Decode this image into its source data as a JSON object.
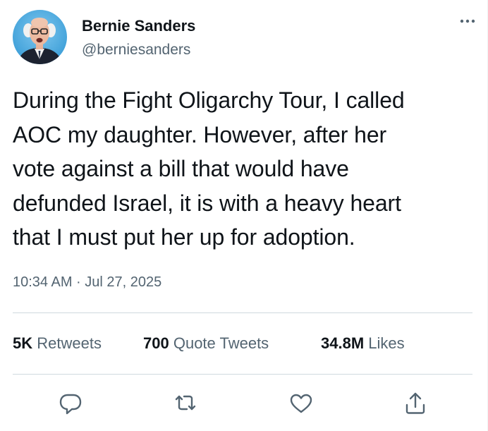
{
  "author": {
    "display_name": "Bernie Sanders",
    "handle": "@berniesanders",
    "avatar_icon": "profile-photo"
  },
  "tweet": {
    "text": "During the Fight Oligarchy Tour, I called\nAOC my daughter. However, after her\nvote against a bill that would have\ndefunded Israel, it is with a heavy heart\nthat I must put her up for adoption.",
    "timestamp": "10:34 AM · Jul 27, 2025"
  },
  "stats": {
    "retweets_count": "5K",
    "retweets_label": "Retweets",
    "quotes_count": "700",
    "quotes_label": "Quote Tweets",
    "likes_count": "34.8M",
    "likes_label": "Likes"
  },
  "actions": {
    "reply_icon": "reply-icon",
    "retweet_icon": "retweet-icon",
    "like_icon": "like-icon",
    "share_icon": "share-icon",
    "more_icon": "more-icon"
  },
  "colors": {
    "accent": "#1d9bf0",
    "primary_text": "#0f1419",
    "secondary_text": "#536471",
    "divider": "#cfd9de"
  }
}
